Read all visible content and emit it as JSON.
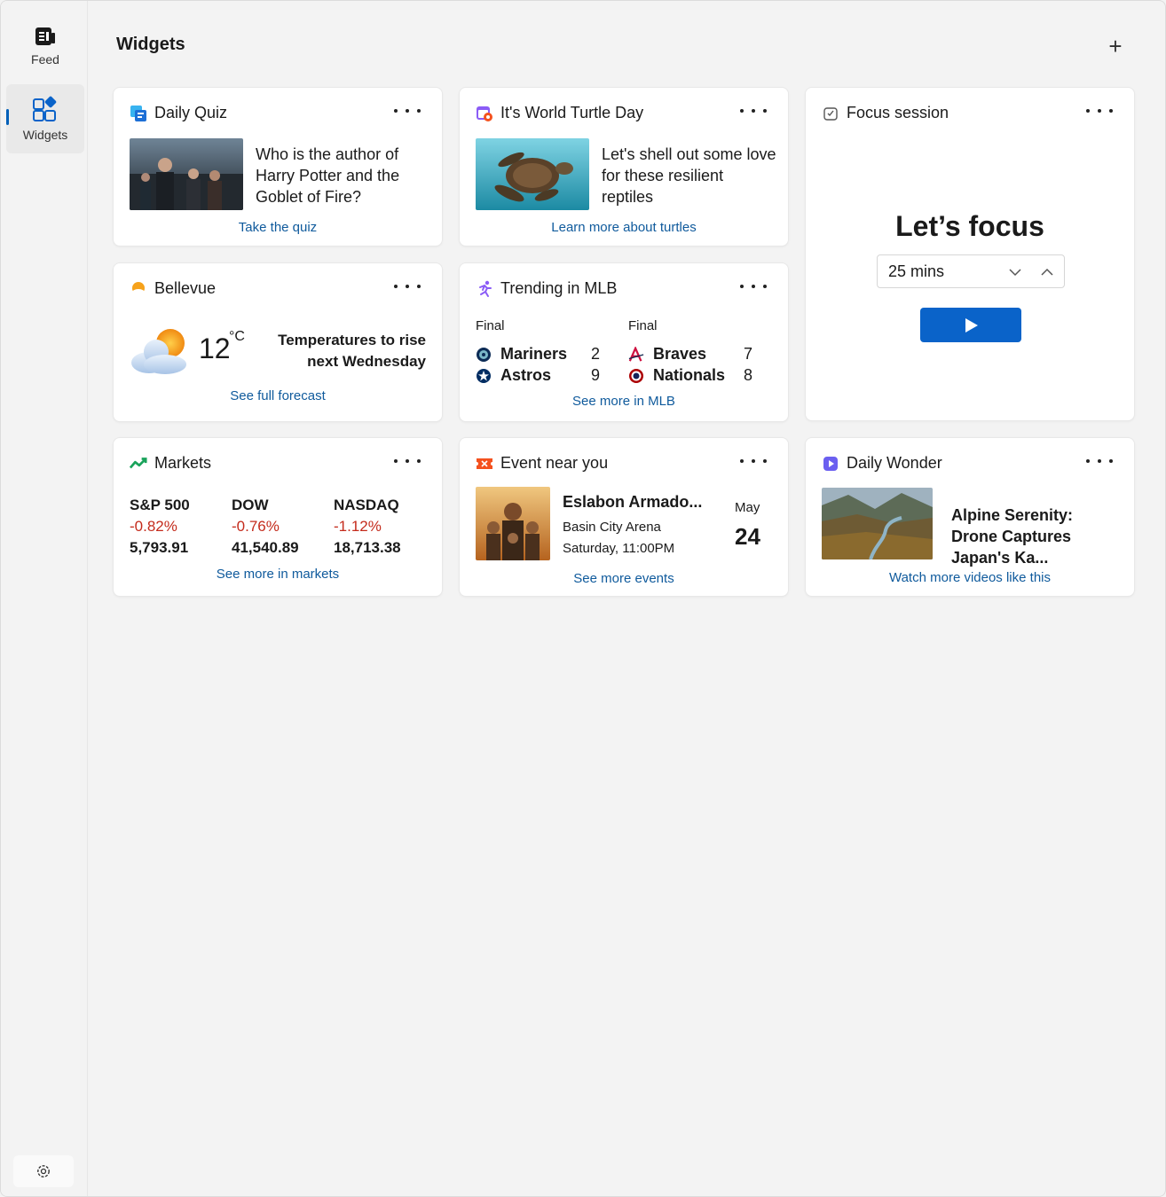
{
  "sidebar": {
    "feed_label": "Feed",
    "widgets_label": "Widgets",
    "feed_icon": "feed-icon",
    "widgets_icon": "widgets-icon",
    "settings_icon": "gear-icon"
  },
  "header": {
    "title": "Widgets",
    "add_icon": "+"
  },
  "colors": {
    "accent": "#005fb8",
    "link": "#0f5a9c",
    "negative": "#c42b1c",
    "play": "#0a63c9"
  },
  "quiz": {
    "title": "Daily Quiz",
    "question": "Who is the author of Harry Potter and the Goblet of Fire?",
    "link": "Take the quiz"
  },
  "turtle": {
    "title": "It's World Turtle Day",
    "text": "Let's shell out some love for these resilient reptiles",
    "link": "Learn more about turtles"
  },
  "focus": {
    "title": "Focus session",
    "heading": "Let’s focus",
    "duration": "25 mins"
  },
  "weather": {
    "title": "Bellevue",
    "temp": "12",
    "unit": "°C",
    "forecast": "Temperatures to rise next Wednesday",
    "link": "See full forecast"
  },
  "mlb": {
    "title": "Trending in MLB",
    "games": [
      {
        "status": "Final",
        "teams": [
          {
            "name": "Mariners",
            "score": "2"
          },
          {
            "name": "Astros",
            "score": "9"
          }
        ]
      },
      {
        "status": "Final",
        "teams": [
          {
            "name": "Braves",
            "score": "7"
          },
          {
            "name": "Nationals",
            "score": "8"
          }
        ]
      }
    ],
    "link": "See more in MLB"
  },
  "markets": {
    "title": "Markets",
    "indices": [
      {
        "name": "S&P 500",
        "change": "-0.82%",
        "value": "5,793.91"
      },
      {
        "name": "DOW",
        "change": "-0.76%",
        "value": "41,540.89"
      },
      {
        "name": "NASDAQ",
        "change": "-1.12%",
        "value": "18,713.38"
      }
    ],
    "link": "See more in markets"
  },
  "event": {
    "title": "Event near you",
    "name": "Eslabon Armado...",
    "venue": "Basin City Arena",
    "time": "Saturday, 11:00PM",
    "month": "May",
    "day": "24",
    "link": "See more events"
  },
  "wonder": {
    "title": "Daily Wonder",
    "headline": "Alpine Serenity: Drone Captures Japan's Ka...",
    "link": "Watch more videos like this"
  }
}
